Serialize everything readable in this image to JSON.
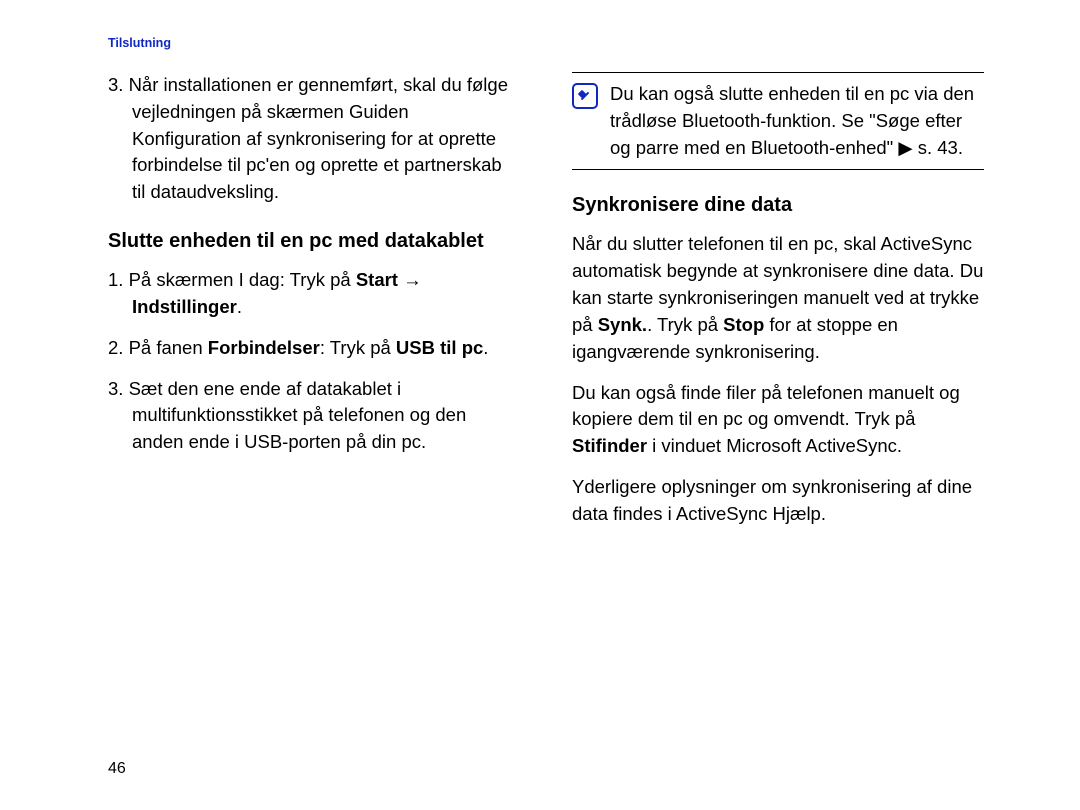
{
  "header": {
    "section": "Tilslutning"
  },
  "page_number": "46",
  "left": {
    "continued_step3": "3. Når installationen er gennemført, skal du følge vejledningen på skærmen Guiden Konfiguration af synkronisering for at oprette forbindelse til pc'en og oprette et partnerskab til dataudveksling.",
    "heading": "Slutte enheden til en pc med datakablet",
    "steps": {
      "s1_prefix": "1. På skærmen I dag: Tryk på ",
      "s1_bold1": "Start",
      "s1_arrow": " → ",
      "s1_bold2": "Indstillinger",
      "s1_period": ".",
      "s2_prefix": "2. På fanen ",
      "s2_bold1": "Forbindelser",
      "s2_mid": ": Tryk på ",
      "s2_bold2": "USB til pc",
      "s2_period": ".",
      "s3": "3. Sæt den ene ende af datakablet i multifunktionsstikket på telefonen og den anden ende i USB-porten på din pc."
    }
  },
  "right": {
    "note": "Du kan også slutte enheden til en pc via den trådløse Bluetooth-funktion. Se \"Søge efter og parre med en Bluetooth-enhed\" ▶ s. 43.",
    "heading": "Synkronisere dine data",
    "para1_a": "Når du slutter telefonen til en pc, skal ActiveSync automatisk begynde at synkronisere dine data. Du kan starte synkroniseringen manuelt ved at trykke på ",
    "para1_b1": "Synk.",
    "para1_mid": ". Tryk på ",
    "para1_b2": "Stop",
    "para1_c": " for at stoppe en igangværende synkronisering.",
    "para2_a": "Du kan også finde filer på telefonen manuelt og kopiere dem til en pc og omvendt. Tryk på ",
    "para2_b": "Stifinder",
    "para2_c": " i vinduet Microsoft ActiveSync.",
    "para3": "Yderligere oplysninger om synkronisering af dine data findes i ActiveSync Hjælp."
  }
}
